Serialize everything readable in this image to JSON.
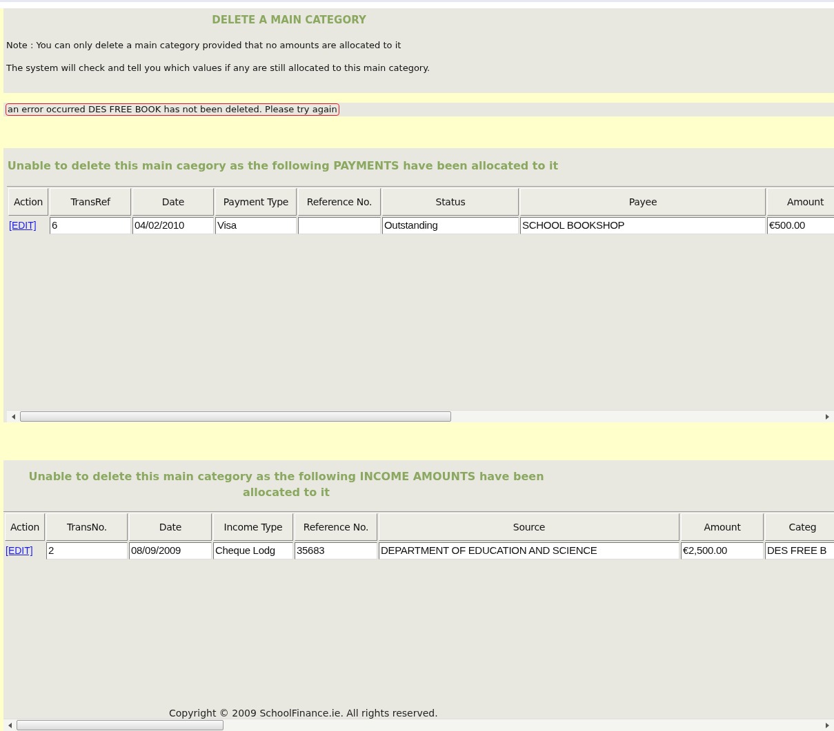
{
  "title": "DELETE A MAIN CATEGORY",
  "notes": [
    "Note : You can only delete a main category provided that no amounts are allocated to it",
    "The system will check and tell you which values if any are still allocated to this main category."
  ],
  "error": "an error occurred DES FREE BOOK has not been deleted. Please try again",
  "sections": [
    {
      "heading": "Unable to delete this main caegory as the following PAYMENTS have been allocated to it",
      "columns": [
        "Action",
        "TransRef",
        "Date",
        "Payment Type",
        "Reference No.",
        "Status",
        "Payee",
        "Amount"
      ],
      "rows": [
        {
          "cells": [
            "[EDIT]",
            "6",
            "04/02/2010",
            "Visa",
            "",
            "Outstanding",
            "SCHOOL BOOKSHOP",
            "€500.00"
          ]
        }
      ]
    },
    {
      "heading": "Unable to delete this main category as the following INCOME AMOUNTS have been allocated to it",
      "columns": [
        "Action",
        "TransNo.",
        "Date",
        "Income Type",
        "Reference No.",
        "Source",
        "Amount",
        "Categ"
      ],
      "rows": [
        {
          "cells": [
            "[EDIT]",
            "2",
            "08/09/2009",
            "Cheque Lodg",
            "35683",
            "DEPARTMENT OF EDUCATION AND SCIENCE",
            "€2,500.00",
            "DES FREE B"
          ]
        }
      ]
    }
  ],
  "footer": "Copyright © 2009 SchoolFinance.ie. All rights reserved."
}
